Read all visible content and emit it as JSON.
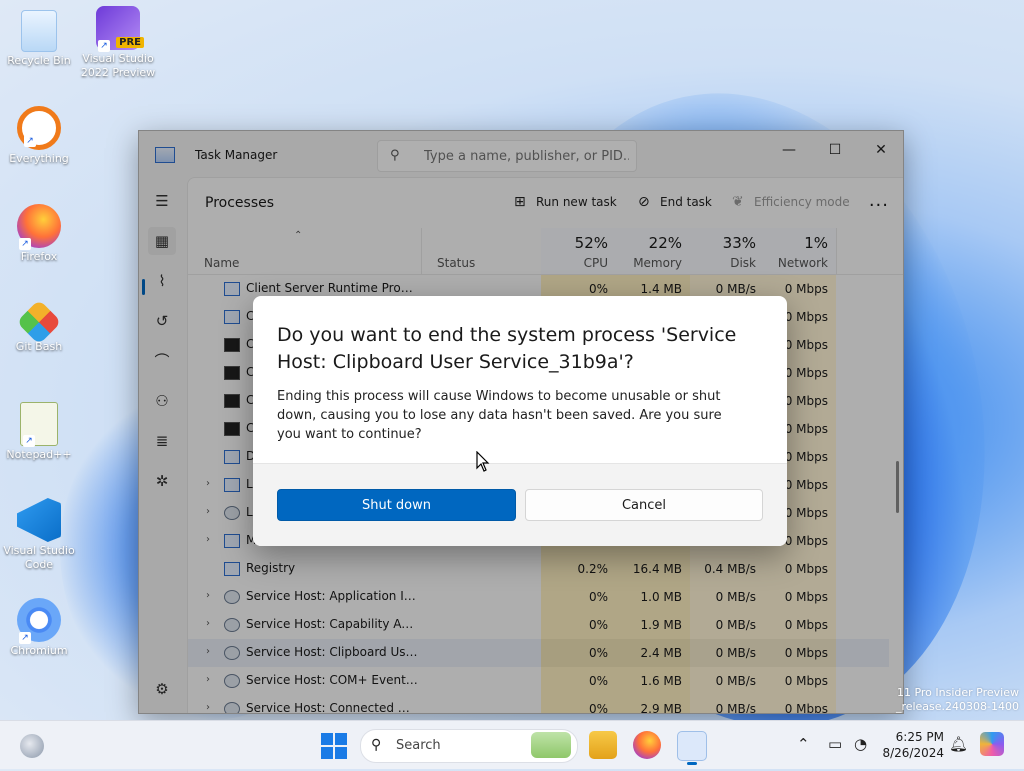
{
  "desktop": {
    "icons": [
      {
        "label": "Recycle Bin",
        "icon": "recycle-bin-icon"
      },
      {
        "label": "Visual Studio 2022 Preview",
        "badge": "PRE",
        "icon": "visual-studio-preview-icon"
      },
      {
        "label": "Everything",
        "icon": "everything-search-icon"
      },
      {
        "label": "Firefox",
        "icon": "firefox-icon"
      },
      {
        "label": "Git Bash",
        "icon": "git-bash-icon"
      },
      {
        "label": "Notepad++",
        "icon": "notepadpp-icon"
      },
      {
        "label": "Visual Studio Code",
        "icon": "vscode-icon"
      },
      {
        "label": "Chromium",
        "icon": "chromium-icon"
      }
    ],
    "watermark": {
      "line1": "11 Pro Insider Preview",
      "line2": "_release.240308-1400"
    }
  },
  "task_manager": {
    "title": "Task Manager",
    "search_placeholder": "Type a name, publisher, or PID...",
    "page_title": "Processes",
    "toolbar": {
      "run_new_task": "Run new task",
      "end_task": "End task",
      "efficiency_mode": "Efficiency mode",
      "more": "..."
    },
    "columns": {
      "name": "Name",
      "status": "Status",
      "cpu": {
        "pct": "52%",
        "label": "CPU"
      },
      "memory": {
        "pct": "22%",
        "label": "Memory"
      },
      "disk": {
        "pct": "33%",
        "label": "Disk"
      },
      "network": {
        "pct": "1%",
        "label": "Network"
      }
    },
    "rows": [
      {
        "name": "Client Server Runtime Process",
        "cpu": "0%",
        "mem": "1.4 MB",
        "disk": "0 MB/s",
        "net": "0 Mbps",
        "icon": "app",
        "expand": false
      },
      {
        "name": "C",
        "cpu": "",
        "mem": "",
        "disk": "",
        "net": "0 Mbps",
        "icon": "app",
        "expand": false
      },
      {
        "name": "C",
        "cpu": "",
        "mem": "",
        "disk": "",
        "net": "0 Mbps",
        "icon": "cmd",
        "expand": false
      },
      {
        "name": "C",
        "cpu": "",
        "mem": "",
        "disk": "",
        "net": "0 Mbps",
        "icon": "cmd",
        "expand": false
      },
      {
        "name": "C",
        "cpu": "",
        "mem": "",
        "disk": "",
        "net": "0 Mbps",
        "icon": "cmd",
        "expand": false
      },
      {
        "name": "C",
        "cpu": "",
        "mem": "",
        "disk": "",
        "net": "0 Mbps",
        "icon": "cmd",
        "expand": false
      },
      {
        "name": "D",
        "cpu": "",
        "mem": "",
        "disk": "",
        "net": "0 Mbps",
        "icon": "app",
        "expand": false
      },
      {
        "name": "L",
        "cpu": "",
        "mem": "",
        "disk": "",
        "net": "0 Mbps",
        "icon": "app",
        "expand": true
      },
      {
        "name": "L",
        "cpu": "",
        "mem": "",
        "disk": "",
        "net": "0 Mbps",
        "icon": "gear",
        "expand": true
      },
      {
        "name": "M",
        "cpu": "",
        "mem": "",
        "disk": "",
        "net": "0 Mbps",
        "icon": "app",
        "expand": true
      },
      {
        "name": "Registry",
        "cpu": "0.2%",
        "mem": "16.4 MB",
        "disk": "0.4 MB/s",
        "net": "0 Mbps",
        "icon": "app",
        "expand": false
      },
      {
        "name": "Service Host: Application Infor...",
        "cpu": "0%",
        "mem": "1.0 MB",
        "disk": "0 MB/s",
        "net": "0 Mbps",
        "icon": "gear",
        "expand": true
      },
      {
        "name": "Service Host: Capability Acces...",
        "cpu": "0%",
        "mem": "1.9 MB",
        "disk": "0 MB/s",
        "net": "0 Mbps",
        "icon": "gear",
        "expand": true
      },
      {
        "name": "Service Host: Clipboard User S...",
        "cpu": "0%",
        "mem": "2.4 MB",
        "disk": "0 MB/s",
        "net": "0 Mbps",
        "icon": "gear",
        "expand": true,
        "selected": true
      },
      {
        "name": "Service Host: COM+ Event Sys...",
        "cpu": "0%",
        "mem": "1.6 MB",
        "disk": "0 MB/s",
        "net": "0 Mbps",
        "icon": "gear",
        "expand": true
      },
      {
        "name": "Service Host: Connected Devi...",
        "cpu": "0%",
        "mem": "2.9 MB",
        "disk": "0 MB/s",
        "net": "0 Mbps",
        "icon": "gear",
        "expand": true
      }
    ]
  },
  "dialog": {
    "title": "Do you want to end the system process 'Service Host: Clipboard User Service_31b9a'?",
    "body": "Ending this process will cause Windows to become unusable or shut down, causing you to lose any data hasn't been saved. Are you sure you want to continue?",
    "primary_button": "Shut down",
    "secondary_button": "Cancel"
  },
  "taskbar": {
    "search_label": "Search",
    "time": "6:25 PM",
    "date": "8/26/2024"
  },
  "colors": {
    "accent": "#0067c0",
    "usage_cell": "#fdeec1"
  }
}
